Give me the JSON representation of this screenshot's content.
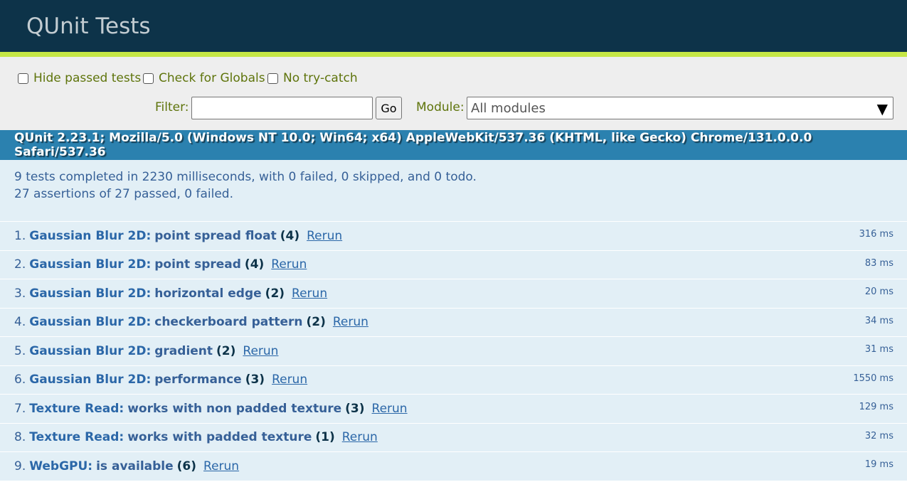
{
  "header": {
    "title": "QUnit Tests"
  },
  "toolbar": {
    "hide_passed": "Hide passed tests",
    "check_globals": "Check for Globals",
    "no_try_catch": "No try-catch",
    "filter_label": "Filter:",
    "filter_value": "",
    "go_label": "Go",
    "module_label": "Module:",
    "module_value": "All modules"
  },
  "user_agent": "QUnit 2.23.1; Mozilla/5.0 (Windows NT 10.0; Win64; x64) AppleWebKit/537.36 (KHTML, like Gecko) Chrome/131.0.0.0 Safari/537.36",
  "result": {
    "line1": "9 tests completed in 2230 milliseconds, with 0 failed, 0 skipped, and 0 todo.",
    "line2": "27 assertions of 27 passed, 0 failed."
  },
  "rerun_label": "Rerun",
  "tests": [
    {
      "num": "1.",
      "module": "Gaussian Blur 2D:",
      "name": "point spread float",
      "counts": "(4)",
      "runtime": "316 ms"
    },
    {
      "num": "2.",
      "module": "Gaussian Blur 2D:",
      "name": "point spread",
      "counts": "(4)",
      "runtime": "83 ms"
    },
    {
      "num": "3.",
      "module": "Gaussian Blur 2D:",
      "name": "horizontal edge",
      "counts": "(2)",
      "runtime": "20 ms"
    },
    {
      "num": "4.",
      "module": "Gaussian Blur 2D:",
      "name": "checkerboard pattern",
      "counts": "(2)",
      "runtime": "34 ms"
    },
    {
      "num": "5.",
      "module": "Gaussian Blur 2D:",
      "name": "gradient",
      "counts": "(2)",
      "runtime": "31 ms"
    },
    {
      "num": "6.",
      "module": "Gaussian Blur 2D:",
      "name": "performance",
      "counts": "(3)",
      "runtime": "1550 ms"
    },
    {
      "num": "7.",
      "module": "Texture Read:",
      "name": "works with non padded texture",
      "counts": "(3)",
      "runtime": "129 ms"
    },
    {
      "num": "8.",
      "module": "Texture Read:",
      "name": "works with padded texture",
      "counts": "(1)",
      "runtime": "32 ms"
    },
    {
      "num": "9.",
      "module": "WebGPU:",
      "name": "is available",
      "counts": "(6)",
      "runtime": "19 ms"
    }
  ]
}
